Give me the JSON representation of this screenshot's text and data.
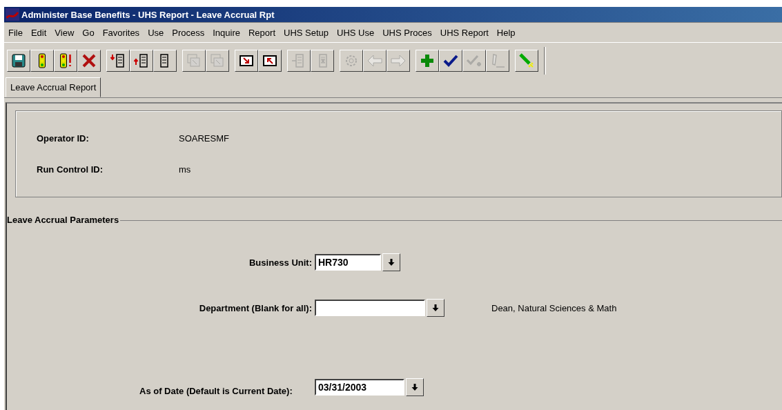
{
  "window": {
    "title": "Administer Base Benefits - UHS Report - Leave Accrual Rpt"
  },
  "menu": [
    "File",
    "Edit",
    "View",
    "Go",
    "Favorites",
    "Use",
    "Process",
    "Inquire",
    "Report",
    "UHS Setup",
    "UHS Use",
    "UHS Proces",
    "UHS Report",
    "Help"
  ],
  "toolbar": [
    [
      {
        "kind": "save",
        "disabled": false
      },
      {
        "kind": "light",
        "disabled": false
      },
      {
        "kind": "light-alert",
        "disabled": false
      },
      {
        "kind": "delete",
        "disabled": false
      }
    ],
    [
      {
        "kind": "list-down",
        "disabled": false
      },
      {
        "kind": "list-up",
        "disabled": false
      },
      {
        "kind": "list",
        "disabled": false
      }
    ],
    [
      {
        "kind": "windows-in",
        "disabled": true
      },
      {
        "kind": "windows-out",
        "disabled": true
      }
    ],
    [
      {
        "kind": "box-down",
        "disabled": false
      },
      {
        "kind": "box-up",
        "disabled": false
      }
    ],
    [
      {
        "kind": "list-insert",
        "disabled": true
      },
      {
        "kind": "list-delete",
        "disabled": true
      }
    ],
    [
      {
        "kind": "gear",
        "disabled": true
      },
      {
        "kind": "left",
        "disabled": true
      },
      {
        "kind": "right",
        "disabled": true
      }
    ],
    [
      {
        "kind": "plus",
        "disabled": false
      },
      {
        "kind": "check",
        "disabled": false
      },
      {
        "kind": "check-plus",
        "disabled": true
      },
      {
        "kind": "pencil",
        "disabled": true
      }
    ],
    [
      {
        "kind": "flashlight",
        "disabled": false
      }
    ]
  ],
  "tabs": [
    {
      "label": "Leave Accrual Report",
      "selected": true
    }
  ],
  "header": [
    {
      "label": "Operator ID:",
      "value": "SOARESMF"
    },
    {
      "label": "Run Control ID:",
      "value": "ms"
    }
  ],
  "parameters": {
    "title": "Leave Accrual Parameters",
    "fields": [
      {
        "label": "Business Unit:",
        "value": "HR730"
      },
      {
        "label": "Department (Blank for all):",
        "description": "Dean, Natural Sciences & Math"
      },
      {
        "label": "As of Date (Default is Current Date):",
        "value": "03/31/2003"
      }
    ]
  }
}
